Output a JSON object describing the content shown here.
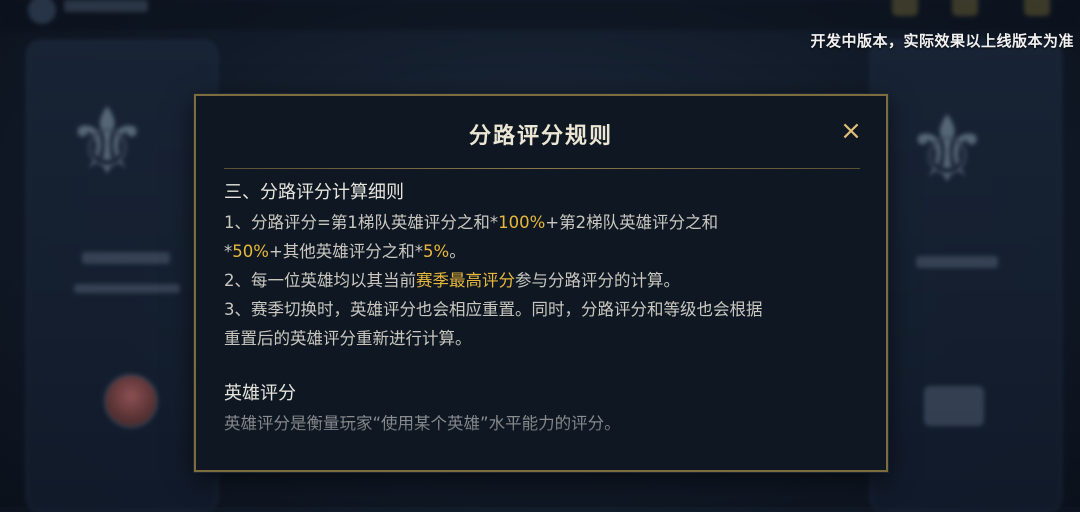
{
  "dev_note": "开发中版本，实际效果以上线版本为准",
  "modal": {
    "title": "分路评分规则",
    "close_label": "×",
    "section_heading": "三、分路评分计算细则",
    "rule1": {
      "pre": " 1、分路评分=第1梯队英雄评分之和*",
      "hl1": "100%",
      "mid": "+第2梯队英雄评分之和",
      "newline_pre": "*",
      "hl2": "50%",
      "mid2": "+其他英雄评分之和*",
      "hl3": "5%",
      "post": "。"
    },
    "rule2": {
      "pre": "2、每一位英雄均以其当前",
      "hl": "赛季最高评分",
      "post": "参与分路评分的计算。"
    },
    "rule3_line1": "3、赛季切换时，英雄评分也会相应重置。同时，分路评分和等级也会根据",
    "rule3_line2": "重置后的英雄评分重新进行计算。",
    "hero_heading": "英雄评分",
    "hero_desc": "英雄评分是衡量玩家“使用某个英雄”水平能力的评分。"
  },
  "colors": {
    "highlight": "#e8b83c",
    "border_gold": "#7c6c3e",
    "close_gold": "#e0c078"
  }
}
